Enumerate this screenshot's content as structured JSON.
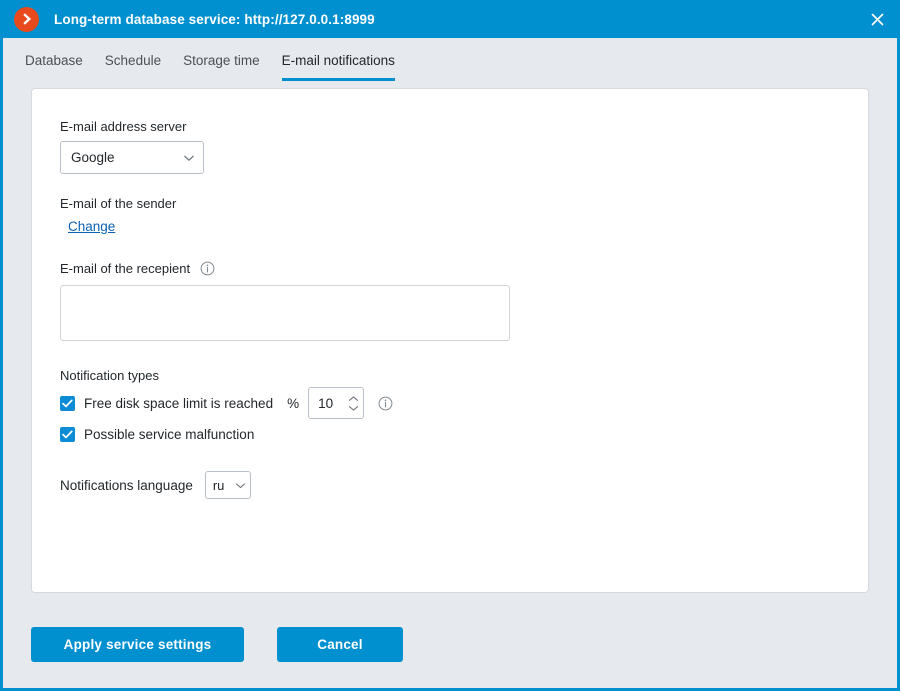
{
  "window": {
    "title": "Long-term database service: http://127.0.0.1:8999",
    "logo_icon": "chevron-right-circle-icon",
    "close_icon": "close-icon",
    "accent_color": "#0090d0",
    "logo_color": "#e8491d"
  },
  "tabs": [
    {
      "label": "Database",
      "active": false
    },
    {
      "label": "Schedule",
      "active": false
    },
    {
      "label": "Storage time",
      "active": false
    },
    {
      "label": "E-mail notifications",
      "active": true
    }
  ],
  "form": {
    "server": {
      "label": "E-mail address server",
      "value": "Google",
      "chevron_icon": "chevron-down-icon"
    },
    "sender": {
      "label": "E-mail of the sender",
      "change_link": "Change"
    },
    "recipient": {
      "label": "E-mail of the recepient",
      "info_icon": "info-icon",
      "value": "",
      "placeholder": ""
    },
    "notifications": {
      "title": "Notification types",
      "items": [
        {
          "label": "Free disk space limit is reached",
          "checked": true,
          "unit": "%",
          "value": "10",
          "info_icon": "info-icon",
          "spinner_up_icon": "chevron-up-icon",
          "spinner_down_icon": "chevron-down-icon"
        },
        {
          "label": "Possible service malfunction",
          "checked": true
        }
      ]
    },
    "language": {
      "label": "Notifications language",
      "value": "ru",
      "chevron_icon": "chevron-down-icon"
    }
  },
  "footer": {
    "apply_label": "Apply service settings",
    "cancel_label": "Cancel"
  }
}
